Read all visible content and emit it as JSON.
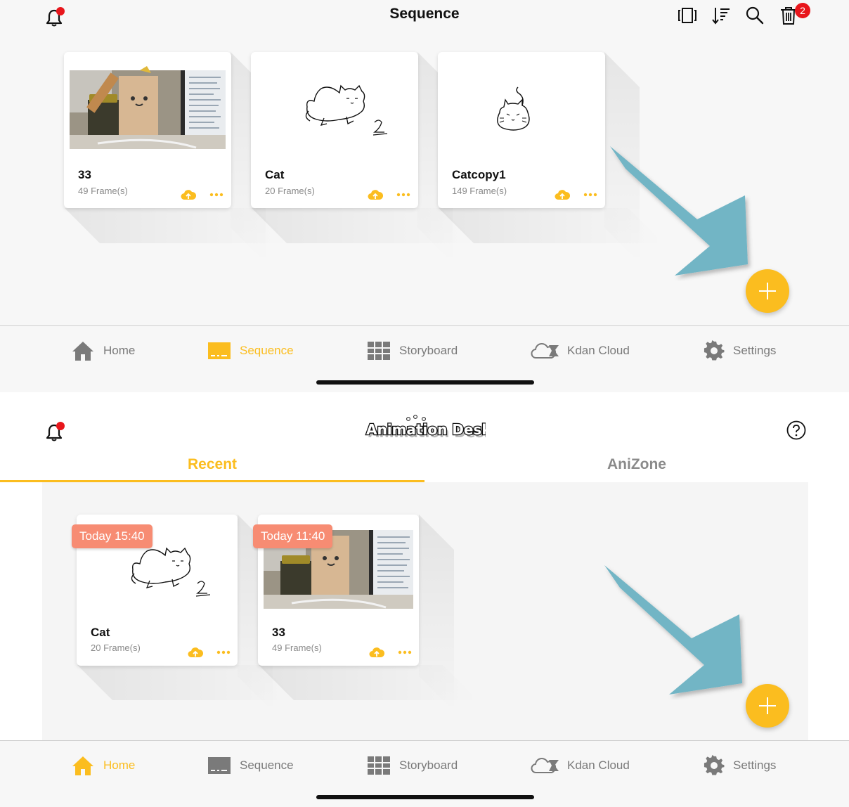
{
  "sequence_screen": {
    "title": "Sequence",
    "trash_badge": "2",
    "cards": [
      {
        "name": "33",
        "frames": "49 Frame(s)",
        "thumb": "photo"
      },
      {
        "name": "Cat",
        "frames": "20 Frame(s)",
        "thumb": "cat-drawing"
      },
      {
        "name": "Catcopy1",
        "frames": "149 Frame(s)",
        "thumb": "cat-sitting"
      }
    ]
  },
  "home_screen": {
    "logo_text": "Animation Desk",
    "tabs": {
      "recent": "Recent",
      "anizone": "AniZone"
    },
    "cards": [
      {
        "name": "Cat",
        "frames": "20 Frame(s)",
        "date": "Today 15:40",
        "thumb": "cat-drawing"
      },
      {
        "name": "33",
        "frames": "49 Frame(s)",
        "date": "Today 11:40",
        "thumb": "photo"
      }
    ]
  },
  "tabbar": {
    "home": "Home",
    "sequence": "Sequence",
    "storyboard": "Storyboard",
    "kdan_cloud": "Kdan Cloud",
    "settings": "Settings"
  },
  "colors": {
    "accent": "#fbbd1f",
    "badge": "#e8161c",
    "date_badge": "#f78c73",
    "arrow": "#72b5c5",
    "inactive": "#7a7a7a"
  },
  "icons": [
    "bell-icon",
    "flip-icon",
    "sort-icon",
    "search-icon",
    "trash-icon",
    "cloud-upload-icon",
    "more-icon",
    "plus-icon",
    "home-icon",
    "sequence-icon",
    "storyboard-icon",
    "kdan-cloud-icon",
    "settings-icon",
    "help-icon"
  ]
}
